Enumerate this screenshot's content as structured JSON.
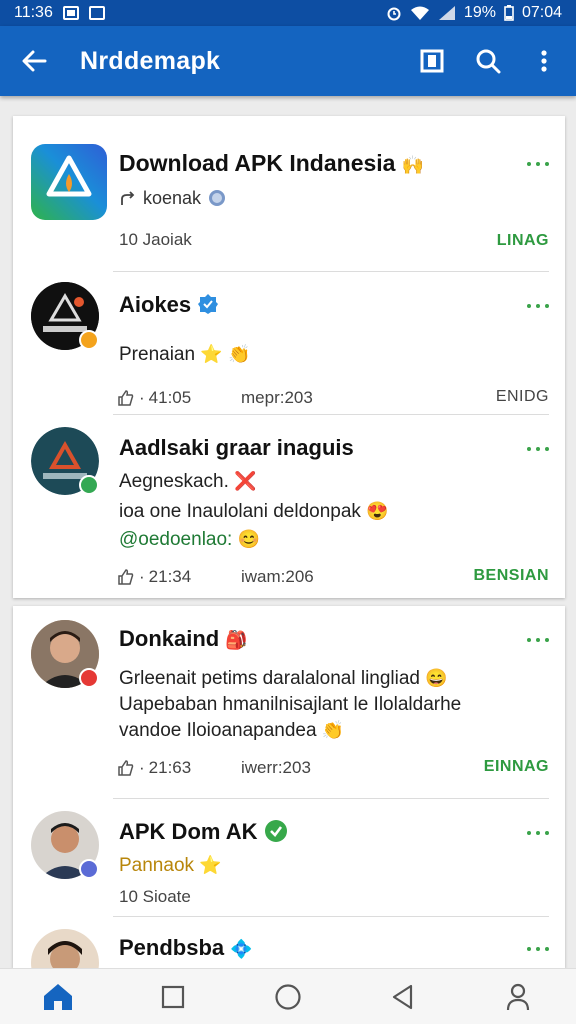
{
  "status_bar": {
    "time_left": "11:36",
    "battery": "19%",
    "time_right": "07:04"
  },
  "app_bar": {
    "title": "Nrddemapk"
  },
  "posts": [
    {
      "title": "Download APK Indanesia",
      "subtitle": "koenak",
      "count": "10  Jaoiak",
      "action": "LINAG"
    },
    {
      "title": "Aiokes",
      "subtitle": "Prenaian",
      "likes": "41:05",
      "meta": "mepr:203",
      "action": "ENIDG"
    },
    {
      "title": "Aadlsaki graar inaguis",
      "line1": "Aegneskаch.",
      "line2": "ioa one Inaulolani deldonpak",
      "line3": "@oedoenlao:",
      "likes": "21:34",
      "meta": "iwam:206",
      "action": "BENSIAN"
    },
    {
      "title": "Donkaind",
      "line1": "Grleenait petims daralalonal lingliad",
      "line2": "Uapebaban hmanilnisajlant le Ilolaldarhe",
      "line3": "vandoe Iloioanapandea",
      "likes": "21:63",
      "meta": "iwerr:203",
      "action": "EINNAG"
    },
    {
      "title": "APK Dom AK",
      "subtitle": "Pannaok",
      "count": "10  Sioate"
    },
    {
      "title": "Pendbsba"
    }
  ],
  "icons": [
    "back-arrow-icon",
    "bookmark-icon",
    "search-icon",
    "more-vert-icon",
    "home-icon",
    "square-icon",
    "circle-icon",
    "triangle-back-icon",
    "person-icon"
  ],
  "colors": {
    "status_bar": "#0d4ea3",
    "app_bar": "#1464c0",
    "accent_green": "#2e9a40"
  }
}
